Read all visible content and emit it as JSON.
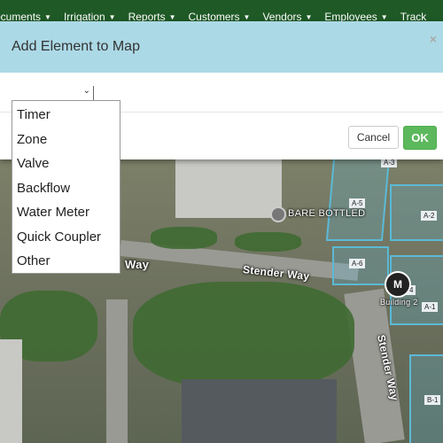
{
  "navbar": {
    "items": [
      {
        "label": "ocuments"
      },
      {
        "label": "Irrigation"
      },
      {
        "label": "Reports"
      },
      {
        "label": "Customers"
      },
      {
        "label": "Vendors"
      },
      {
        "label": "Employees"
      },
      {
        "label": "Track"
      }
    ]
  },
  "modal": {
    "title": "Add Element to Map",
    "close": "×",
    "select_value": "",
    "cancel_label": "Cancel",
    "ok_label": "OK"
  },
  "dropdown": {
    "options": [
      "Timer",
      "Zone",
      "Valve",
      "Backflow",
      "Water Meter",
      "Quick Coupler",
      "Other"
    ]
  },
  "map": {
    "labels": {
      "bare_bottled": "BARE BOTTLED",
      "way": "Way",
      "stender_way": "Stender Way",
      "stender_way_vertical": "Stender Way",
      "building": "Building 2"
    },
    "zones": [
      "A-3",
      "A-5",
      "A-2",
      "A-6",
      "A-4",
      "A-1",
      "B-1"
    ],
    "timer_marker": "M"
  },
  "colors": {
    "navbar": "#1f5a26",
    "modal_header": "#acd9e6",
    "ok_button": "#5cb85c",
    "zone_outline": "#5bb9d6"
  }
}
